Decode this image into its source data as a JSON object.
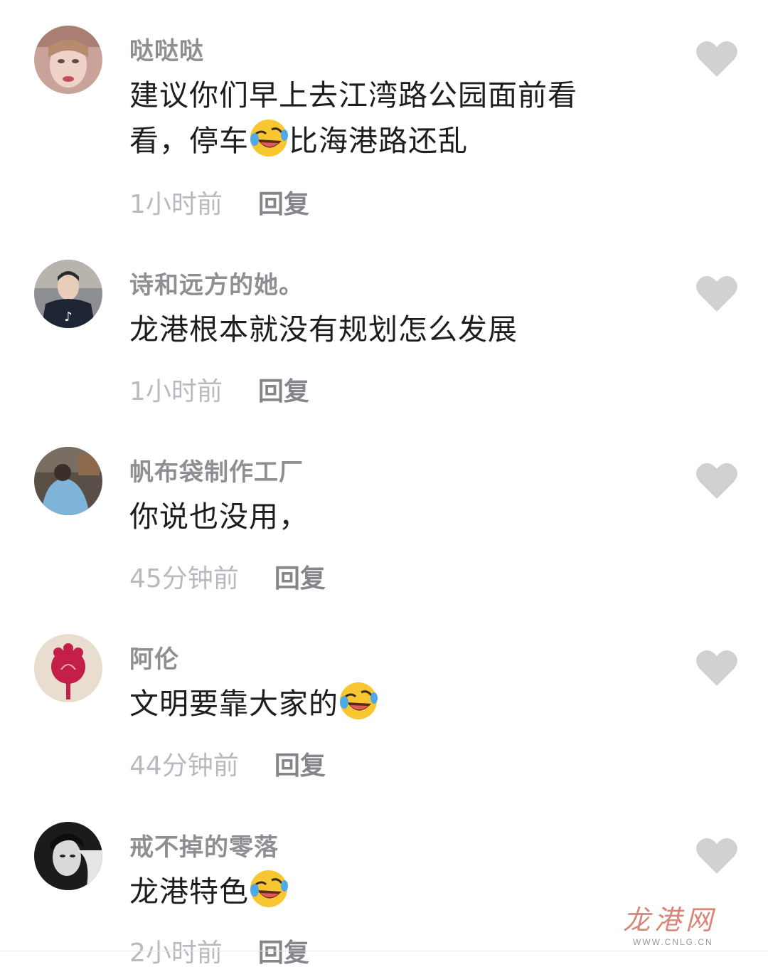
{
  "comments": [
    {
      "username": "哒哒哒",
      "text_parts": [
        "建议你们早上去江湾路公园面前看看，停车",
        "比海港路还乱"
      ],
      "emoji": "rofl-emoji",
      "time": "1小时前",
      "reply": "回复"
    },
    {
      "username": "诗和远方的她。",
      "text_parts": [
        "龙港根本就没有规划怎么发展"
      ],
      "time": "1小时前",
      "reply": "回复"
    },
    {
      "username": "帆布袋制作工厂",
      "text_parts": [
        "你说也没用，"
      ],
      "time": "45分钟前",
      "reply": "回复"
    },
    {
      "username": "阿伦",
      "text_parts": [
        "文明要靠大家的"
      ],
      "emoji": "rofl-emoji",
      "time": "44分钟前",
      "reply": "回复"
    },
    {
      "username": "戒不掉的零落",
      "text_parts": [
        "龙港特色"
      ],
      "emoji": "rofl-emoji",
      "time": "2小时前",
      "reply": "回复"
    }
  ],
  "watermark": {
    "logo": "龙港网",
    "url": "WWW.CNLG.CN"
  },
  "icons": {
    "like": "heart-icon",
    "emoji": "rofl-emoji"
  },
  "colors": {
    "username": "#8e8e93",
    "text": "#1d1d1f",
    "time": "#b9b9bf",
    "reply": "#85858b",
    "heart": "#d1d1d4",
    "watermark": "#d8867a"
  }
}
